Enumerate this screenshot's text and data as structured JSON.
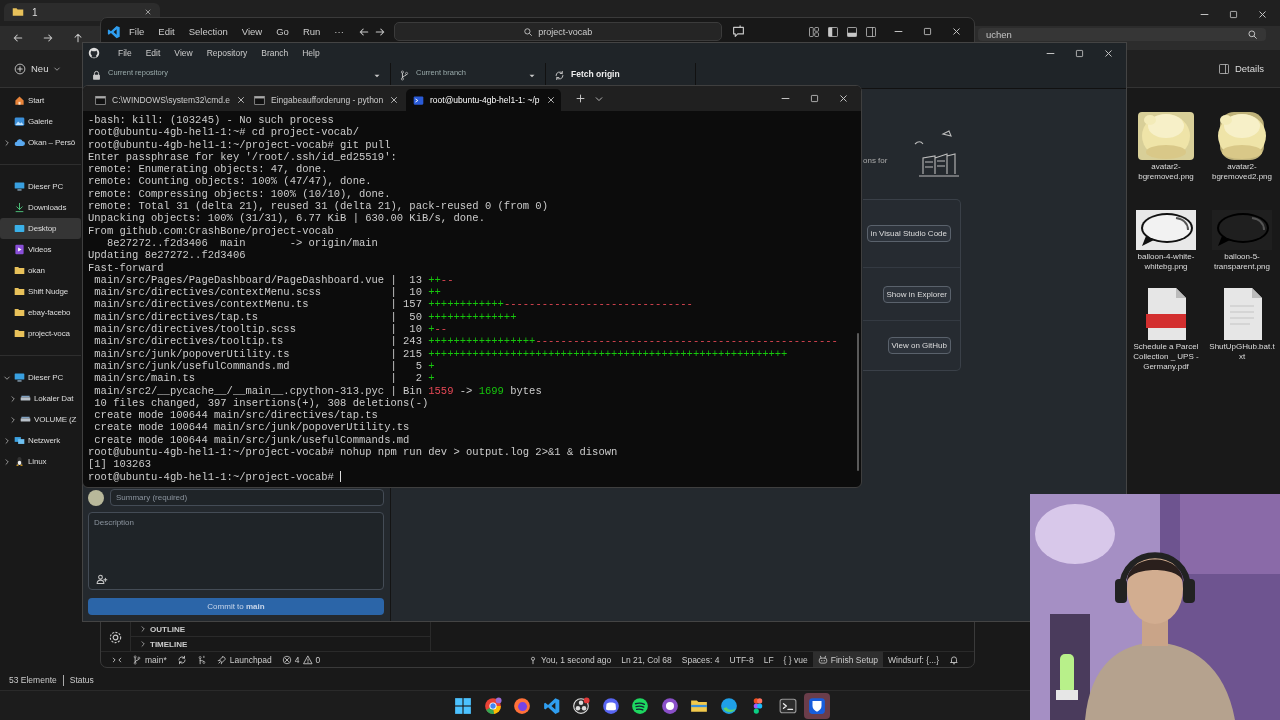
{
  "file_explorer": {
    "tab": {
      "label": "1",
      "selected": true
    },
    "search": {
      "placeholder": "uchen"
    },
    "new_button": "Neu",
    "details_button": "Details",
    "sidebar_groups": [
      {
        "items": [
          {
            "label": "Start",
            "kind": "home",
            "selected": false
          },
          {
            "label": "Galerie",
            "kind": "gallery",
            "selected": false
          },
          {
            "label": "Okan – Persö",
            "kind": "cloud",
            "selected": false,
            "expanded": false
          }
        ]
      },
      {
        "items": [
          {
            "label": "Dieser PC",
            "kind": "pc",
            "selected": false
          },
          {
            "label": "Downloads",
            "kind": "download",
            "selected": false
          },
          {
            "label": "Desktop",
            "kind": "desktop",
            "selected": true
          },
          {
            "label": "Videos",
            "kind": "video",
            "selected": false
          },
          {
            "label": "okan",
            "kind": "folder",
            "selected": false
          },
          {
            "label": "Shift Nudge",
            "kind": "folder",
            "selected": false
          },
          {
            "label": "ebay-facebo",
            "kind": "folder",
            "selected": false
          },
          {
            "label": "project-voca",
            "kind": "folder",
            "selected": false
          }
        ]
      },
      {
        "items": [
          {
            "label": "Dieser PC",
            "kind": "pc",
            "selected": false,
            "expanded": true,
            "children": [
              {
                "label": "Lokaler Dat",
                "kind": "drive",
                "selected": false,
                "expanded": false
              },
              {
                "label": "VOLUME (Z",
                "kind": "drive",
                "selected": false,
                "expanded": false
              }
            ]
          },
          {
            "label": "Netzwerk",
            "kind": "network",
            "selected": false,
            "expanded": false
          },
          {
            "label": "Linux",
            "kind": "linux",
            "selected": false,
            "expanded": false
          }
        ]
      }
    ],
    "files": [
      {
        "name": "avatar2-bgremoved.png",
        "kind": "picture"
      },
      {
        "name": "avatar2-bgremoved2.png",
        "kind": "picture"
      },
      {
        "name": "balloon-4-white-whitebg.png",
        "kind": "picture"
      },
      {
        "name": "balloon-5-transparent.png",
        "kind": "picture"
      },
      {
        "name": "Schedule a Parcel Collection _ UPS - Germany.pdf",
        "kind": "pdf"
      },
      {
        "name": "ShutUpGHub.bat.txt",
        "kind": "text"
      }
    ],
    "status": {
      "count": "53 Elemente",
      "label": "Status"
    }
  },
  "vscode": {
    "menu": [
      "File",
      "Edit",
      "Selection",
      "View",
      "Go",
      "Run",
      "···"
    ],
    "search": "project-vocab",
    "panels": [
      {
        "label": "OUTLINE",
        "expanded": false
      },
      {
        "label": "TIMELINE",
        "expanded": false
      }
    ],
    "status_left": [
      {
        "kind": "remote"
      },
      {
        "kind": "branch",
        "text": "main*"
      },
      {
        "kind": "sync"
      },
      {
        "kind": "graph"
      },
      {
        "kind": "launchpad",
        "text": "Launchpad"
      },
      {
        "kind": "problems",
        "errors": "4",
        "warnings": "0"
      }
    ],
    "status_right": [
      {
        "kind": "blame",
        "text": "You, 1 second ago"
      },
      {
        "kind": "text",
        "text": "Ln 21, Col 68"
      },
      {
        "kind": "text",
        "text": "Spaces: 4"
      },
      {
        "kind": "text",
        "text": "UTF-8"
      },
      {
        "kind": "text",
        "text": "LF"
      },
      {
        "kind": "language",
        "glyph": "{ }",
        "text": "vue"
      },
      {
        "kind": "copilot",
        "text": "Finish Setup"
      },
      {
        "kind": "text",
        "text": "Windsurf: {...}"
      },
      {
        "kind": "bell"
      }
    ]
  },
  "github_desktop": {
    "menu": [
      "File",
      "Edit",
      "View",
      "Repository",
      "Branch",
      "Help"
    ],
    "toolbar": [
      {
        "kind": "repository",
        "label": "Current repository"
      },
      {
        "kind": "branch",
        "label": "Current branch"
      },
      {
        "kind": "fetch",
        "label": "Fetch origin"
      }
    ],
    "partial_text": "ons for",
    "actions": [
      "in Visual Studio Code",
      "Show in Explorer",
      "View on GitHub"
    ],
    "summary_placeholder": "Summary (required)",
    "description_placeholder": "Description",
    "commit_button": "Commit to **main**"
  },
  "terminal": {
    "tabs": [
      {
        "label": "C:\\WINDOWS\\system32\\cmd.e",
        "kind": "cmd",
        "selected": false
      },
      {
        "label": "Eingabeaufforderung - python",
        "kind": "cmd",
        "selected": false
      },
      {
        "label": "root@ubuntu-4gb-hel1-1: ~/p",
        "kind": "shell",
        "selected": true
      }
    ],
    "lines": [
      {
        "text": "-bash: kill: (103245) - No such process"
      },
      {
        "text": "root@ubuntu-4gb-hel1-1:~# cd project-vocab/"
      },
      {
        "text": "root@ubuntu-4gb-hel1-1:~/project-vocab# git pull"
      },
      {
        "text": "Enter passphrase for key '/root/.ssh/id_ed25519':"
      },
      {
        "text": "remote: Enumerating objects: 47, done."
      },
      {
        "text": "remote: Counting objects: 100% (47/47), done."
      },
      {
        "text": "remote: Compressing objects: 100% (10/10), done."
      },
      {
        "text": "remote: Total 31 (delta 21), reused 31 (delta 21), pack-reused 0 (from 0)"
      },
      {
        "text": "Unpacking objects: 100% (31/31), 6.77 KiB | 630.00 KiB/s, done."
      },
      {
        "text": "From github.com:CrashBone/project-vocab"
      },
      {
        "text": "   8e27272..f2d3406  main       -> origin/main"
      },
      {
        "text": "Updating 8e27272..f2d3406"
      },
      {
        "text": "Fast-forward"
      },
      {
        "parts": [
          {
            "kind": "path",
            "text": "main/src/Pages/PageDashboard/PageDashboard.vue"
          },
          {
            "kind": "plain",
            "text": "|  13 "
          },
          {
            "kind": "added",
            "text": "++"
          },
          {
            "kind": "removed",
            "text": "--"
          }
        ]
      },
      {
        "parts": [
          {
            "kind": "path",
            "text": "main/src/directives/contextMenu.scss"
          },
          {
            "kind": "plain",
            "text": "|  10 "
          },
          {
            "kind": "added",
            "text": "++"
          }
        ]
      },
      {
        "parts": [
          {
            "kind": "path",
            "text": "main/src/directives/contextMenu.ts"
          },
          {
            "kind": "plain",
            "text": "| 157 "
          },
          {
            "kind": "added",
            "text": "++++++++++++"
          },
          {
            "kind": "removed",
            "text": "------------------------------"
          }
        ]
      },
      {
        "parts": [
          {
            "kind": "path",
            "text": "main/src/directives/tap.ts"
          },
          {
            "kind": "plain",
            "text": "|  50 "
          },
          {
            "kind": "added",
            "text": "++++++++++++++"
          }
        ]
      },
      {
        "parts": [
          {
            "kind": "path",
            "text": "main/src/directives/tooltip.scss"
          },
          {
            "kind": "plain",
            "text": "|  10 "
          },
          {
            "kind": "added",
            "text": "+"
          },
          {
            "kind": "removed",
            "text": "--"
          }
        ]
      },
      {
        "parts": [
          {
            "kind": "path",
            "text": "main/src/directives/tooltip.ts"
          },
          {
            "kind": "plain",
            "text": "| 243 "
          },
          {
            "kind": "added",
            "text": "+++++++++++++++++"
          },
          {
            "kind": "removed",
            "text": "------------------------------------------------"
          }
        ]
      },
      {
        "parts": [
          {
            "kind": "path",
            "text": "main/src/junk/popoverUtility.ts"
          },
          {
            "kind": "plain",
            "text": "| 215 "
          },
          {
            "kind": "added",
            "text": "+++++++++++++++++++++++++++++++++++++++++++++++++++++++++"
          }
        ]
      },
      {
        "parts": [
          {
            "kind": "path",
            "text": "main/src/junk/usefulCommands.md"
          },
          {
            "kind": "plain",
            "text": "|   5 "
          },
          {
            "kind": "added",
            "text": "+"
          }
        ]
      },
      {
        "parts": [
          {
            "kind": "path",
            "text": "main/src/main.ts"
          },
          {
            "kind": "plain",
            "text": "|   2 "
          },
          {
            "kind": "added",
            "text": "+"
          }
        ]
      },
      {
        "parts": [
          {
            "kind": "path",
            "text": "main/src2/__pycache__/__main__.cpython-313.pyc"
          },
          {
            "kind": "plain",
            "text": "| Bin "
          },
          {
            "kind": "removed",
            "text": "1559"
          },
          {
            "kind": "plain",
            "text": " -> "
          },
          {
            "kind": "added",
            "text": "1699"
          },
          {
            "kind": "plain",
            "text": " bytes"
          }
        ]
      },
      {
        "text": " 10 files changed, 397 insertions(+), 308 deletions(-)"
      },
      {
        "text": " create mode 100644 main/src/directives/tap.ts"
      },
      {
        "text": " create mode 100644 main/src/junk/popoverUtility.ts"
      },
      {
        "text": " create mode 100644 main/src/junk/usefulCommands.md"
      },
      {
        "text": "root@ubuntu-4gb-hel1-1:~/project-vocab# nohup npm run dev > output.log 2>&1 & disown"
      },
      {
        "text": "[1] 103263"
      },
      {
        "text": "root@ubuntu-4gb-hel1-1:~/project-vocab#",
        "cursor": true
      }
    ]
  },
  "taskbar": {
    "apps": [
      {
        "kind": "start",
        "selected": false
      },
      {
        "kind": "chrome",
        "selected": false
      },
      {
        "kind": "firefox",
        "selected": false
      },
      {
        "kind": "vscode",
        "selected": false
      },
      {
        "kind": "obs",
        "selected": false
      },
      {
        "kind": "discord",
        "selected": false
      },
      {
        "kind": "spotify",
        "selected": false
      },
      {
        "kind": "github",
        "selected": false
      },
      {
        "kind": "explorer",
        "selected": false
      },
      {
        "kind": "edge",
        "selected": false
      },
      {
        "kind": "figma",
        "selected": false
      },
      {
        "kind": "terminal",
        "selected": false
      },
      {
        "kind": "bitwarden",
        "selected": true
      }
    ]
  }
}
